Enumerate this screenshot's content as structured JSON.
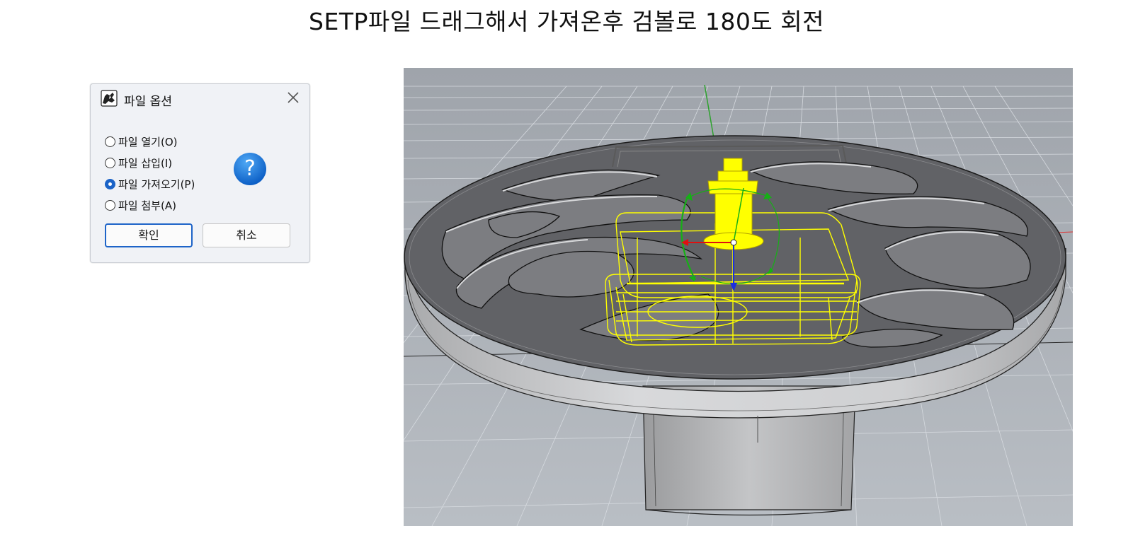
{
  "page": {
    "title": "SETP파일 드래그해서 가져온후 검볼로 180도 회전"
  },
  "dialog": {
    "title": "파일 옵션",
    "app_icon": "rhino-icon",
    "close_icon": "close-icon",
    "help_icon": "help-icon",
    "help_glyph": "?",
    "options": [
      {
        "label": "파일 열기(O)",
        "checked": false
      },
      {
        "label": "파일 삽입(I)",
        "checked": false
      },
      {
        "label": "파일 가져오기(P)",
        "checked": true
      },
      {
        "label": "파일 첨부(A)",
        "checked": false
      }
    ],
    "ok_label": "확인",
    "cancel_label": "취소"
  },
  "viewport": {
    "name": "perspective-3d-viewport",
    "colors": {
      "background_top": "#9fa4ab",
      "background_bottom": "#b9bec4",
      "grid": "#d8dce0",
      "table_top": "#5f6063",
      "table_side": "#c8c9cb",
      "selection": "#ffff00",
      "gumball_x": "#e01010",
      "gumball_y": "#16b016",
      "gumball_z": "#1b2fe0"
    }
  }
}
